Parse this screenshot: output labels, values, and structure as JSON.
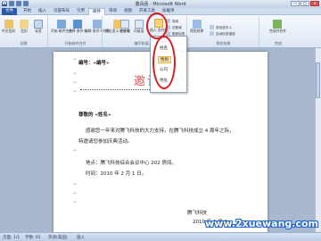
{
  "window": {
    "title": "邀请函 - Microsoft Word",
    "controls": [
      "—",
      "□",
      "✕"
    ]
  },
  "file_tab": "文件",
  "tabs": [
    "开始",
    "插入",
    "页面布局",
    "引用",
    "邮件",
    "审阅",
    "视图",
    "开发工具",
    "加载项"
  ],
  "ribbon": {
    "groups": [
      {
        "name": "创建",
        "buttons": [
          "中文信封",
          "信封",
          "标签"
        ]
      },
      {
        "name": "开始邮件合并",
        "buttons": [
          "开始\n邮件合并",
          "选择\n收件人",
          "编辑\n收件人列表"
        ]
      },
      {
        "name": "编写和插入域",
        "buttons": [
          "突出显示\n合并域",
          "地址块",
          "问候语",
          "插入合并域"
        ]
      },
      {
        "name": "预览结果",
        "buttons": [
          "预览结果"
        ]
      },
      {
        "name": "完成",
        "buttons": [
          "完成并合并"
        ]
      }
    ],
    "small_items": [
      "规则",
      "匹配域",
      "更新标签",
      "查找收件人",
      "自动检查错误"
    ],
    "insert_field_label": "插入\n合并域"
  },
  "dropdown": {
    "items": [
      "姓名",
      "性别",
      "公司",
      "地址"
    ],
    "highlighted": 1
  },
  "document": {
    "header_field": "编号：«编号»",
    "stamp": "邀请函",
    "salutation": "尊敬的 «姓名» ",
    "body1": "感谢您一年来对腾飞科技的大力支持。在腾飞科技成立 4 周年之际，",
    "body2": "特邀请您参加庆典活动。",
    "addr": "地点：腾飞科技综合会议中心 202 房间。",
    "time": "时间：2010 年 2 月 1 日。",
    "sign_company": "腾飞科技",
    "sign_date": "2010 年 1 月 1"
  },
  "status": {
    "page": "页面: 1/1",
    "words": "字数: 81",
    "lang": "英语(美国)",
    "mode": "插入"
  },
  "watermark": "www.2xuewang.com",
  "colors": {
    "ring": "#d21e1e",
    "accent": "#2a5aa8"
  }
}
